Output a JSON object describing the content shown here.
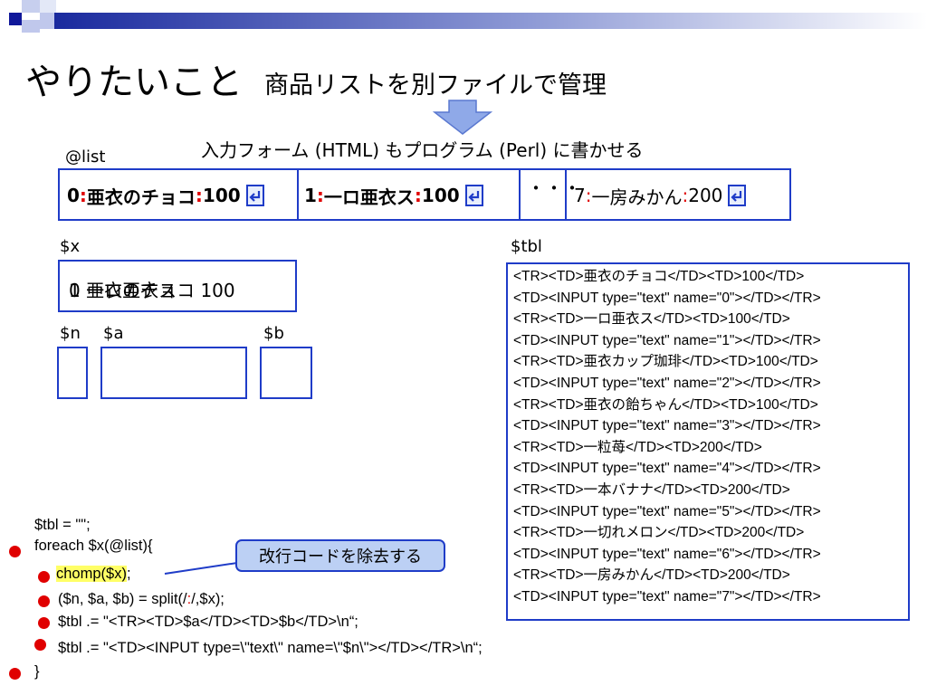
{
  "title": {
    "main": "やりたいこと",
    "sub": "商品リストを別ファイルで管理"
  },
  "subtitle": "入力フォーム (HTML) もプログラム (Perl) に書かせる",
  "labels": {
    "list": "@list",
    "x": "$x",
    "tbl": "$tbl",
    "n": "$n",
    "a": "$a",
    "b": "$b"
  },
  "list_items": [
    {
      "num": "0",
      "sep1": ":",
      "name": "亜衣のチョコ",
      "sep2": ":",
      "price": "100",
      "overlay": "0"
    },
    {
      "num": "1",
      "sep1": ":",
      "name": "一ロ亜衣ス",
      "sep2": ":",
      "price": "100"
    },
    {
      "ellipsis": "・・・"
    },
    {
      "num": "7",
      "sep1": ":",
      "name": "一房みかん",
      "sep2": ":",
      "price": "200"
    }
  ],
  "x_box": {
    "text_a": "0 亜衣のチョコ 100",
    "text_b": "1 一ロ亜衣ス"
  },
  "enter_icon": "enter-arrow-icon",
  "tbl_lines": [
    "<TR><TD>亜衣のチョコ</TD><TD>100</TD>",
    "<TD><INPUT type=\"text\" name=\"0\"></TD></TR>",
    "<TR><TD>一ロ亜衣ス</TD><TD>100</TD>",
    "<TD><INPUT type=\"text\" name=\"1\"></TD></TR>",
    "<TR><TD>亜衣カップ珈琲</TD><TD>100</TD>",
    "<TD><INPUT type=\"text\" name=\"2\"></TD></TR>",
    "<TR><TD>亜衣の飴ちゃん</TD><TD>100</TD>",
    "<TD><INPUT type=\"text\" name=\"3\"></TD></TR>",
    "<TR><TD>一粒苺</TD><TD>200</TD>",
    "<TD><INPUT type=\"text\" name=\"4\"></TD></TR>",
    "<TR><TD>一本バナナ</TD><TD>200</TD>",
    "<TD><INPUT type=\"text\" name=\"5\"></TD></TR>",
    "<TR><TD>一切れメロン</TD><TD>200</TD>",
    "<TD><INPUT type=\"text\" name=\"6\"></TD></TR>",
    "<TR><TD>一房みかん</TD><TD>200</TD>",
    "<TD><INPUT type=\"text\" name=\"7\"></TD></TR>"
  ],
  "code": {
    "line1": "$tbl = \"\";",
    "line2": "foreach $x(@list){",
    "line3_hl": "chomp($x)",
    "line3_rest": ";",
    "line4_a": "($n, $a, $b) = split(/",
    "line4_colon": ":",
    "line4_b": "/,$x);",
    "line5": "$tbl .= \"<TR><TD>$a</TD><TD>$b</TD>\\n“;",
    "line6": "$tbl .= \"<TD><INPUT type=\\\"text\\\" name=\\\"$n\\\"></TD></TR>\\n“;",
    "line7": "}"
  },
  "callout": "改行コードを除去する",
  "colors": {
    "accent_blue": "#1f3cc8",
    "red": "#e00000",
    "arrow_fill": "#8fa9e8",
    "highlight": "#ffff66",
    "callout_bg": "#bcd0f4"
  }
}
